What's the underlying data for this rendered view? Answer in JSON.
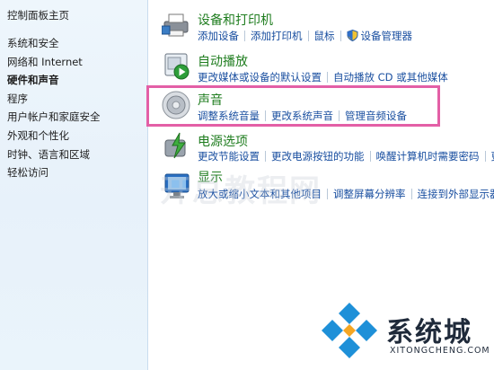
{
  "sidebar": {
    "home": "控制面板主页",
    "items": [
      {
        "label": "系统和安全"
      },
      {
        "label": "网络和 Internet"
      },
      {
        "label": "硬件和声音"
      },
      {
        "label": "程序"
      },
      {
        "label": "用户帐户和家庭安全"
      },
      {
        "label": "外观和个性化"
      },
      {
        "label": "时钟、语言和区域"
      },
      {
        "label": "轻松访问"
      }
    ]
  },
  "categories": {
    "devices": {
      "title": "设备和打印机",
      "icon": "printer-icon",
      "links": [
        "添加设备",
        "添加打印机",
        "鼠标",
        "设备管理器"
      ]
    },
    "autoplay": {
      "title": "自动播放",
      "icon": "autoplay-icon",
      "links": [
        "更改媒体或设备的默认设置",
        "自动播放 CD 或其他媒体"
      ]
    },
    "sound": {
      "title": "声音",
      "icon": "speaker-icon",
      "links": [
        "调整系统音量",
        "更改系统声音",
        "管理音频设备"
      ]
    },
    "power": {
      "title": "电源选项",
      "icon": "power-icon",
      "links": [
        "更改节能设置",
        "更改电源按钮的功能",
        "唤醒计算机时需要密码",
        "更改"
      ]
    },
    "display": {
      "title": "显示",
      "icon": "display-icon",
      "links": [
        "放大或缩小文本和其他项目",
        "调整屏幕分辨率",
        "连接到外部显示器"
      ]
    }
  },
  "watermark": "开总教程网",
  "logo": {
    "brand": "系统城",
    "domain": "XITONGCHENG.COM"
  },
  "colors": {
    "title_green": "#1f7d1f",
    "link_blue": "#1a4fa0",
    "highlight_pink": "#e35fa6",
    "logo_blue": "#1e90d8"
  }
}
